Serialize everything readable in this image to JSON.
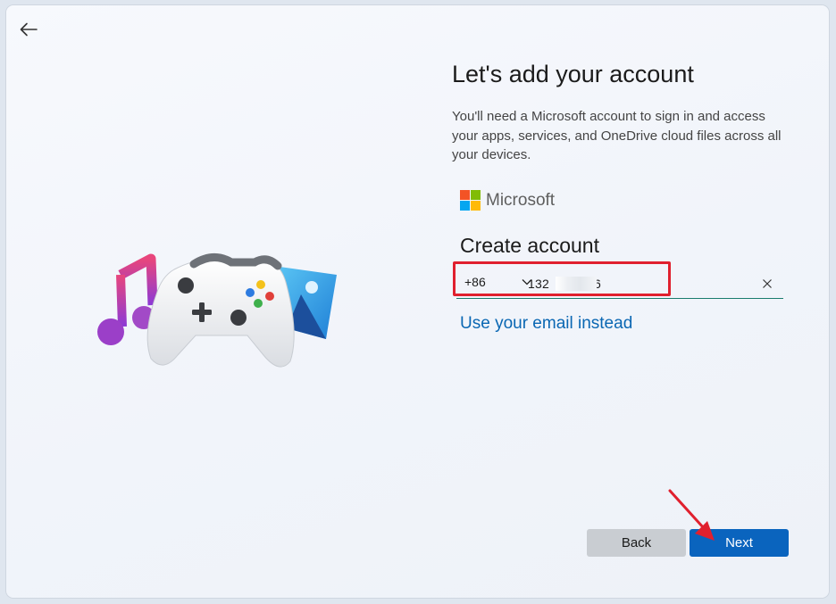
{
  "back_icon": "arrow-left-icon",
  "title": "Let's add your account",
  "description": "You'll need a Microsoft account to sign in and access your apps, services, and OneDrive cloud files across all your devices.",
  "brand": {
    "name": "Microsoft",
    "logo_colors": [
      "#f35325",
      "#81bc06",
      "#05a6f0",
      "#ffba08"
    ]
  },
  "form": {
    "heading": "Create account",
    "country_code": "+86",
    "country_icon": "chevron-down-icon",
    "phone_prefix": "132",
    "phone_suffix": "6",
    "clear_icon": "close-icon",
    "alt_link": "Use your email instead"
  },
  "buttons": {
    "back": "Back",
    "next": "Next"
  },
  "illustration": {
    "icons": [
      "music-note-icon",
      "game-controller-icon",
      "photos-icon"
    ]
  },
  "colors": {
    "accent": "#0a64be",
    "link": "#0a67b3",
    "annotation": "#e0202e",
    "input_underline": "#1a7c6d"
  }
}
